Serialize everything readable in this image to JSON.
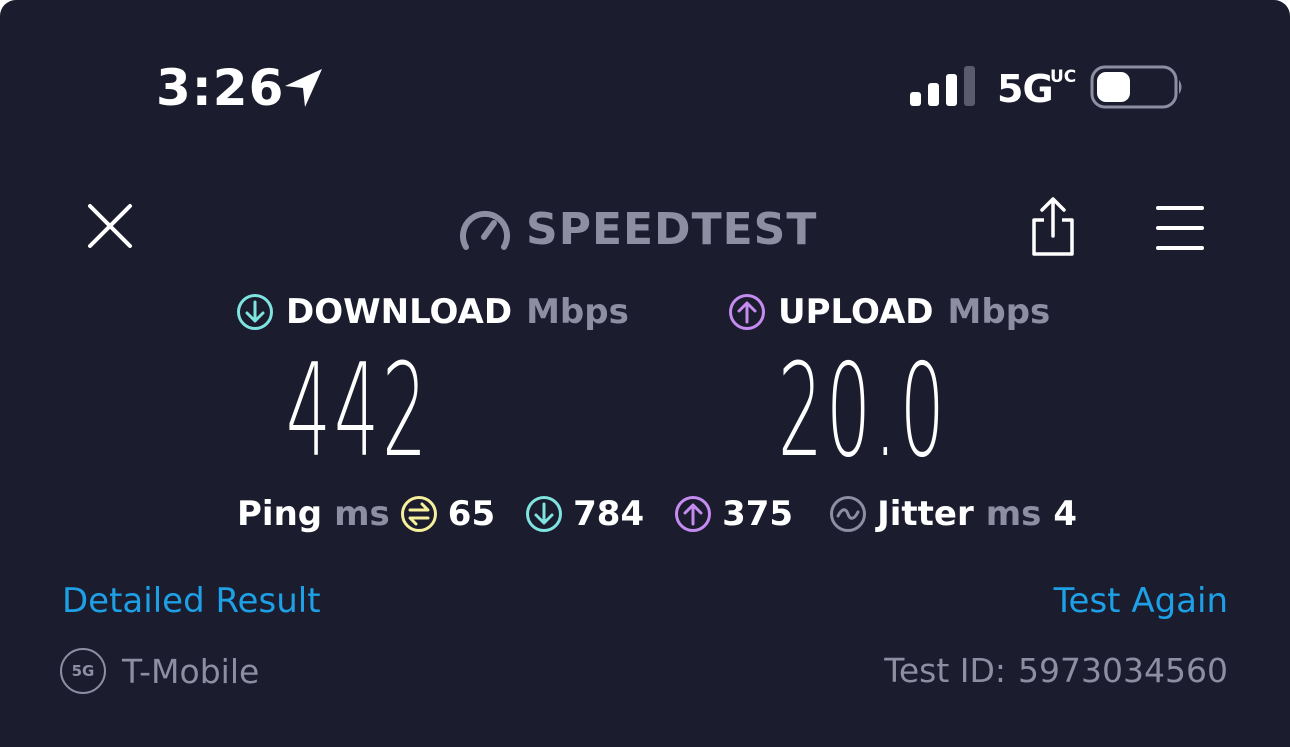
{
  "status_bar": {
    "time": "3:26",
    "network": "5G",
    "network_sub": "UC",
    "signal_bars_active": 3,
    "signal_bars_total": 4,
    "battery_level": 0.45
  },
  "header": {
    "logo_text": "SPEEDTEST"
  },
  "results": {
    "download": {
      "label": "DOWNLOAD",
      "unit": "Mbps",
      "value": "442"
    },
    "upload": {
      "label": "UPLOAD",
      "unit": "Mbps",
      "value": "20.0"
    },
    "ping": {
      "label": "Ping",
      "unit": "ms",
      "idle": "65",
      "download": "784",
      "upload": "375"
    },
    "jitter": {
      "label": "Jitter",
      "unit": "ms",
      "value": "4"
    }
  },
  "links": {
    "detailed_result": "Detailed Result",
    "test_again": "Test Again"
  },
  "footer": {
    "carrier_badge": "5G",
    "carrier": "T-Mobile",
    "test_id_label": "Test ID:",
    "test_id": "5973034560"
  },
  "colors": {
    "background": "#1b1c2e",
    "download_accent": "#7fe3e0",
    "upload_accent": "#c48cf0",
    "ping_accent": "#f6ef9b",
    "link": "#1ea0e6",
    "muted": "#8d8ea2"
  },
  "icons": {
    "close": "close-icon",
    "share": "share-icon",
    "menu": "menu-icon",
    "gauge": "gauge-icon",
    "location": "location-arrow-icon"
  }
}
